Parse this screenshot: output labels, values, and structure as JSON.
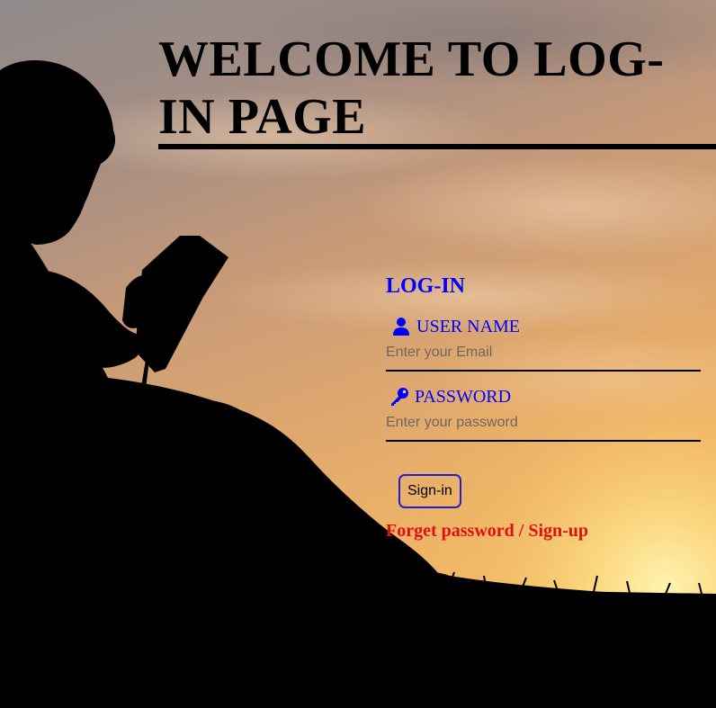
{
  "page": {
    "title": "WELCOME TO LOG-IN PAGE"
  },
  "login": {
    "heading": "LOG-IN",
    "username": {
      "label": "USER NAME",
      "placeholder": "Enter your Email",
      "value": "",
      "icon": "user-icon"
    },
    "password": {
      "label": "PASSWORD",
      "placeholder": "Enter your password",
      "value": "",
      "icon": "key-icon"
    },
    "signin_label": "Sign-in",
    "forget_label": "Forget password",
    "separator": " / ",
    "signup_label": "Sign-up"
  },
  "colors": {
    "accent_blue": "#0000ff",
    "link_red": "#e01010",
    "button_border": "#2020d0",
    "sky_top": "#8f8a8a",
    "sunset": "#f5c270"
  }
}
